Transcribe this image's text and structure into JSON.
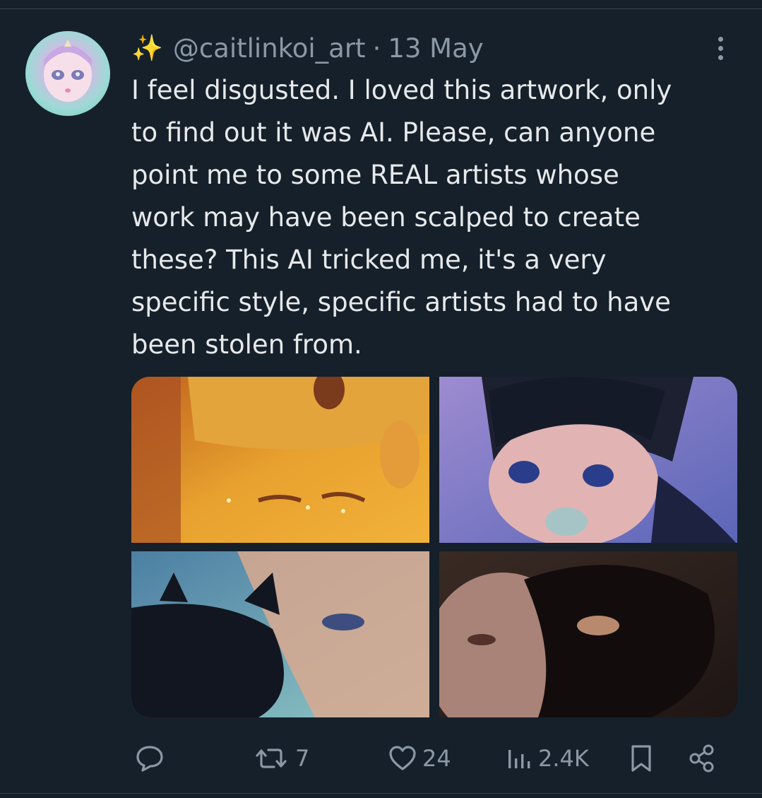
{
  "tweet": {
    "sparkle": "✨",
    "handle": "@caitlinkoi_art",
    "separator": "·",
    "date": "13 May",
    "text": "I feel disgusted. I loved this artwork, only\nto find out it was AI. Please, can anyone\npoint me to some REAL artists whose\nwork may have been scalped to create\nthese? This AI tricked me, it's a very\nspecific style, specific artists had to have\nbeen stolen from."
  },
  "actions": {
    "retweets": "7",
    "likes": "24",
    "views": "2.4K"
  },
  "colors": {
    "background": "#15202b",
    "text": "#e7e9ea",
    "muted": "#8b98a5",
    "divider": "#38444d"
  }
}
